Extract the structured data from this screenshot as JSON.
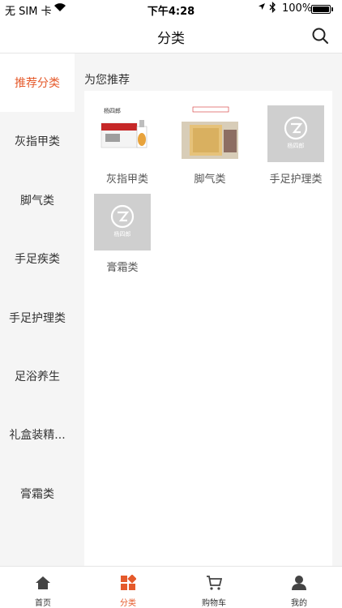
{
  "status_bar": {
    "carrier": "无 SIM 卡",
    "time": "下午4:28",
    "battery_pct": "100%",
    "battery_level": 1.0
  },
  "nav": {
    "title": "分类"
  },
  "sidebar": {
    "items": [
      {
        "label": "推荐分类",
        "active": true
      },
      {
        "label": "灰指甲类"
      },
      {
        "label": "脚气类"
      },
      {
        "label": "手足疾类"
      },
      {
        "label": "手足护理类"
      },
      {
        "label": "足浴养生"
      },
      {
        "label": "礼盒装精..."
      },
      {
        "label": "膏霜类"
      }
    ]
  },
  "content": {
    "section_title": "为您推荐",
    "categories": [
      {
        "label": "灰指甲类",
        "icon": "nail-product-image",
        "brand_text": "杨四郎"
      },
      {
        "label": "脚气类",
        "icon": "foot-product-image"
      },
      {
        "label": "手足护理类",
        "icon": "placeholder-logo-image",
        "brand_text": "杨四郎"
      },
      {
        "label": "膏霜类",
        "icon": "placeholder-logo-image",
        "brand_text": "杨四郎"
      }
    ]
  },
  "tab_bar": {
    "tabs": [
      {
        "label": "首页",
        "icon": "home-icon"
      },
      {
        "label": "分类",
        "icon": "category-icon",
        "active": true
      },
      {
        "label": "购物车",
        "icon": "cart-icon"
      },
      {
        "label": "我的",
        "icon": "profile-icon"
      }
    ]
  },
  "colors": {
    "accent": "#e55a2b",
    "text": "#333333",
    "background": "#f5f5f5"
  }
}
